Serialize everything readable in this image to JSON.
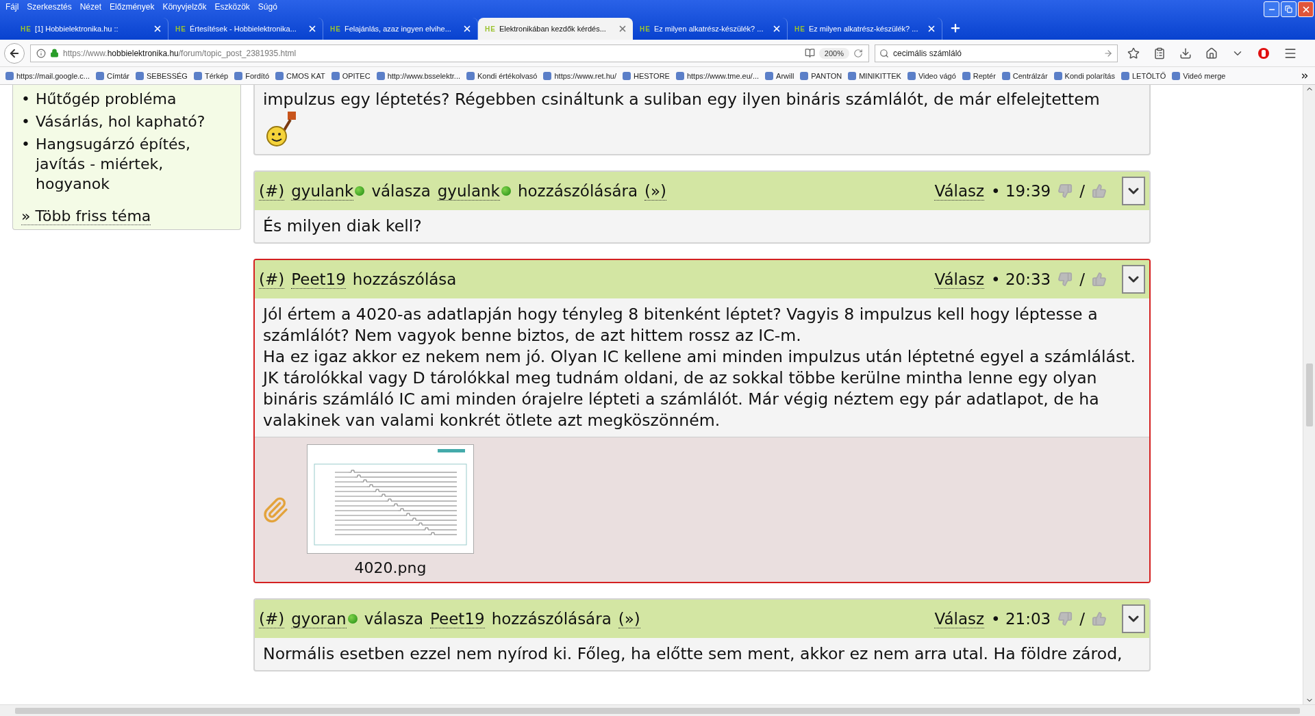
{
  "menu": [
    "Fájl",
    "Szerkesztés",
    "Nézet",
    "Előzmények",
    "Könyvjelzők",
    "Eszközök",
    "Súgó"
  ],
  "tabs": [
    {
      "icon_text": "HE",
      "label": "[1] Hobbielektronika.hu ::",
      "selected": false
    },
    {
      "icon_text": "HE",
      "label": "Értesítések - Hobbielektronika...",
      "selected": false
    },
    {
      "icon_text": "HE",
      "label": "Felajánlás, azaz ingyen elvihe...",
      "selected": false
    },
    {
      "icon_text": "HE",
      "label": "Elektronikában kezdők kérdés...",
      "selected": true
    },
    {
      "icon_text": "HE",
      "label": "Ez milyen alkatrész-készülék? ...",
      "selected": false
    },
    {
      "icon_text": "HE",
      "label": "Ez milyen alkatrész-készülék? ...",
      "selected": false
    }
  ],
  "address": {
    "prefix": "https://www.",
    "domain": "hobbielektronika.hu",
    "path": "/forum/topic_post_2381935.html",
    "zoom": "200%"
  },
  "search": {
    "value": "cecimális számláló"
  },
  "bookmarks": [
    "https://mail.google.c...",
    "Címtár",
    "SEBESSÉG",
    "Térkép",
    "Fordító",
    "CMOS KAT",
    "OPITEC",
    "http://www.bsselektr...",
    "Kondi értékolvasó",
    "https://www.ret.hu/",
    "HESTORE",
    "https://www.tme.eu/...",
    "Arwill",
    "PANTON",
    "MINIKITTEK",
    "Video vágó",
    "Reptér",
    "Centrálzár",
    "Kondi polarítás",
    "LETÖLTŐ",
    "Videó merge"
  ],
  "sidebar": {
    "items": [
      {
        "bullet": "•",
        "label": "Hűtőgép probléma"
      },
      {
        "bullet": "•",
        "label": "Vásárlás, hol kapható?"
      },
      {
        "bullet": "•",
        "label": "Hangsugárzó építés, javítás - miértek, hogyanok"
      }
    ],
    "more_link": "» Több friss téma"
  },
  "posts": [
    {
      "kind": "continued",
      "highlighted": false,
      "body": [
        "impulzus egy léptetés? Régebben csináltunk a suliban egy ilyen bináris számlálót, de már elfelejtettem"
      ],
      "smiley": true
    },
    {
      "kind": "reply",
      "highlighted": false,
      "header": {
        "hash": "(#)",
        "author": "gyulank",
        "author_online": true,
        "verb": "válasza",
        "target": "gyulank",
        "target_online": true,
        "suffix": "hozzászólására",
        "jump": "(»)"
      },
      "reply_link": "Válasz",
      "time": "• 19:39",
      "separator": "/",
      "body": [
        "És milyen diak kell?"
      ]
    },
    {
      "kind": "post",
      "highlighted": true,
      "header": {
        "hash": "(#)",
        "author": "Peet19",
        "author_online": false,
        "verb": "hozzászólása"
      },
      "reply_link": "Válasz",
      "time": "• 20:33",
      "separator": "/",
      "body": [
        "Jól értem a 4020-as adatlapján hogy tényleg 8 bitenként léptet? Vagyis 8 impulzus kell hogy léptesse a számlálót? Nem vagyok benne biztos, de azt hittem rossz az IC-m.",
        "Ha ez igaz akkor ez nekem nem jó. Olyan IC kellene ami minden impulzus után léptetné egyel a számlálást. JK tárolókkal vagy D tárolókkal meg tudnám oldani, de az sokkal többe kerülne mintha lenne egy olyan bináris számláló IC ami minden órajelre lépteti a számlálót. Már végig néztem egy pár adatlapot, de ha valakinek van valami konkrét ötlete azt megköszönném."
      ],
      "attachments": [
        {
          "filename": "4020.png"
        }
      ]
    },
    {
      "kind": "reply",
      "highlighted": false,
      "header": {
        "hash": "(#)",
        "author": "gyoran",
        "author_online": true,
        "verb": "válasza",
        "target": "Peet19",
        "target_online": false,
        "suffix": "hozzászólására",
        "jump": "(»)"
      },
      "reply_link": "Válasz",
      "time": "• 21:03",
      "separator": "/",
      "body": [
        "Normális esetben ezzel nem nyírod ki. Főleg, ha előtte sem ment, akkor ez nem arra utal. Ha földre zárod,"
      ]
    }
  ]
}
